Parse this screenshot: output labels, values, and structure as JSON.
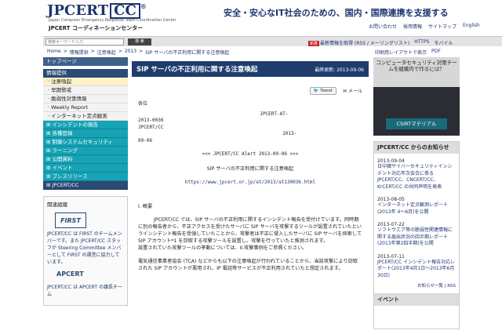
{
  "header": {
    "logo_main": "JPCERT",
    "logo_cc": "CC",
    "logo_reg": "®",
    "logo_sub": "Japan Computer Emergency Response Team Coordination Center",
    "logo_jp": "JPCERT コーディネーションセンター",
    "tagline": "安全・安心なIT社会のための、国内・国際連携を支援する",
    "links": [
      "お問い合わせ",
      "採用情報",
      "サイトマップ",
      "English"
    ]
  },
  "search": {
    "placeholder": "検索キーワード入力",
    "button": "検 索"
  },
  "toplinks": {
    "new_badge": "新着",
    "items": [
      "最新情報を取得 (RSS / メーリングリスト)",
      "HTTPS",
      "モバイル"
    ]
  },
  "breadcrumb": [
    "Home",
    "情報提供",
    "注意喚起",
    "2013",
    "SIP サーバの不正利用に関する注意喚起"
  ],
  "print_links": [
    "印刷用レイアウトで表示",
    "PDF"
  ],
  "sidebar": {
    "top": "トップページ",
    "section": "情報提供",
    "subitems": [
      "注意喚起",
      "早期警戒",
      "脆弱性対策情報",
      "Weekly Report",
      "インターネット定点観測"
    ],
    "categories": [
      "インシデントの報告",
      "各種登録",
      "制御システムセキュリティ",
      "ラーニング",
      "公開資料",
      "イベント",
      "プレスリリース",
      "JPCERT/CC"
    ],
    "related_title": "関連組織",
    "first_logo": "FIRST",
    "first_text": "JPCERT/CC は FIRST のチームメンバーです。また JPCERT/CC スタッフが Steering Committee メンバーとして FIRST の運営に協力しています。",
    "apcert_logo": "APCERT",
    "apcert_text": "JPCERT/CC は APCERT の議長チーム"
  },
  "main": {
    "title": "SIP サーバの不正利用に関する注意喚起",
    "updated": "最終更新: 2013-09-06",
    "tweet": "Tweet",
    "mail": "メール",
    "line_to": "各位",
    "header_block": "                                           JPCERT-AT-\n2013-0036\nJPCERT/CC\n                                                   2013-\n09-06",
    "alert_title": "<<< JPCERT/CC Alert 2013-09-06 >>>",
    "alert_name": "SIP サーバの不正利用に関する注意喚起",
    "url": "https://www.jpcert.or.jp/at/2013/at130036.html",
    "section1": "I. 概要",
    "para1": "JPCERT/CC では、SIP サーバの不正利用に関するインシデント報告を受付けています。同時期に別の報告者から、不正アクセスを受けたサーバに SIP サーバを攻撃するツールが設置されていたというインシデント報告を受領していたことから、攻撃者は不正に侵入したサーバに SIP サーバを探索して SIP アカウント*1 を窃取する攻撃ツールを設置し、攻撃を行っていたと推測されます。",
    "para2": "設置されていた攻撃ツールの挙動については、II.攻撃事例をご参照ください。",
    "para3": "電気通信事業者協会 (TCA) などからも以下の注意喚起が行われていることから、当該攻撃により窃取された SIP アカウントが悪用され、IP 電話等サービスが不正利用されていたと想定されます。"
  },
  "right": {
    "banner_text": "コンピュータセキュリティ対策チームを組織内で作るには？",
    "banner_button": "CSIRTマテリアル",
    "news_title": "JPCERT/CC からのお知らせ",
    "news": [
      {
        "date": "2013-09-04",
        "text": "日中韓サイバーセキュリティインシデント対応年次会合に係る JPCERT/CC、CNCERT/CC、KrCERT/CC の共同声明を発表"
      },
      {
        "date": "2013-08-05",
        "text": "インターネット定点観測レポート(2013年 4〜6月)を公開"
      },
      {
        "date": "2013-07-22",
        "text": "ソフトウエア等の脆弱性関連情報に関する届出状況の四半期レポート(2013年第2四半期)を公開"
      },
      {
        "date": "2013-07-11",
        "text": "JPCERT/CC インシデント報告対応レポート(2013年4月1日〜2013年6月30日)"
      }
    ],
    "news_rss": "お知らせ一覧 | RSS",
    "news2_title": "イベント"
  },
  "colors": {
    "brand": "#1e3470",
    "title_bar": "#1e3d6e",
    "sidebar_cat": "#16a3b5",
    "badge_red": "#c8202a"
  }
}
